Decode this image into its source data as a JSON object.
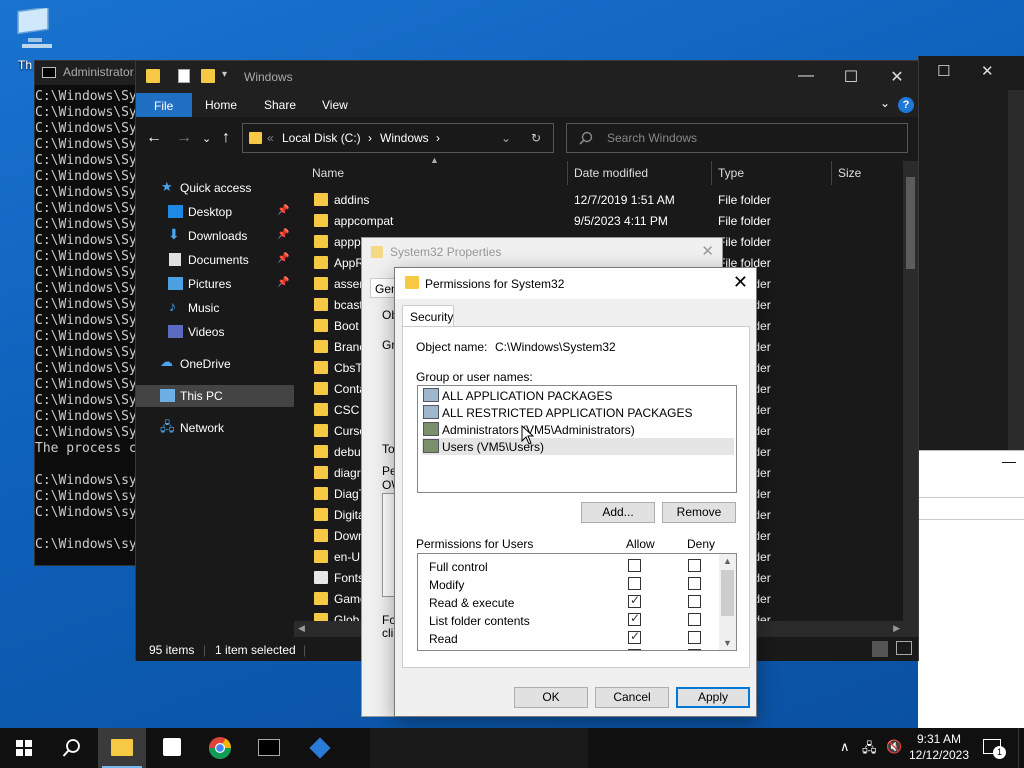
{
  "desktop": {
    "this_pc_label": "Th"
  },
  "cmd": {
    "title": "Administrator",
    "lines": [
      "C:\\Windows\\Sy",
      "C:\\Windows\\Sy",
      "C:\\Windows\\Sy",
      "C:\\Windows\\Sy",
      "C:\\Windows\\Sy",
      "C:\\Windows\\Sy",
      "C:\\Windows\\Sy",
      "C:\\Windows\\Sy",
      "C:\\Windows\\Sy",
      "C:\\Windows\\Sy",
      "C:\\Windows\\Sy",
      "C:\\Windows\\Sy",
      "C:\\Windows\\Sy",
      "C:\\Windows\\Sy",
      "C:\\Windows\\Sy",
      "C:\\Windows\\Sy",
      "C:\\Windows\\Sy",
      "C:\\Windows\\Sy",
      "C:\\Windows\\Sy",
      "C:\\Windows\\Sy",
      "C:\\Windows\\Sy",
      "C:\\Windows\\Sy",
      "The process c",
      "",
      "C:\\Windows\\sy",
      "C:\\Windows\\sy",
      "C:\\Windows\\sy",
      "",
      "C:\\Windows\\sy"
    ]
  },
  "explorer": {
    "title": "Windows",
    "ribbon": {
      "file": "File",
      "home": "Home",
      "share": "Share",
      "view": "View",
      "help": "?"
    },
    "address": {
      "overflow": "«",
      "disk": "Local Disk (C:)",
      "sep1": "›",
      "folder": "Windows",
      "sep2": "›"
    },
    "search_placeholder": "Search Windows",
    "nav": {
      "quick_access": "Quick access",
      "desktop": "Desktop",
      "downloads": "Downloads",
      "documents": "Documents",
      "pictures": "Pictures",
      "music": "Music",
      "videos": "Videos",
      "onedrive": "OneDrive",
      "this_pc": "This PC",
      "network": "Network"
    },
    "columns": {
      "name": "Name",
      "date": "Date modified",
      "type": "Type",
      "size": "Size"
    },
    "rows": [
      {
        "name": "addins",
        "date": "12/7/2019 1:51 AM",
        "type": "File folder"
      },
      {
        "name": "appcompat",
        "date": "9/5/2023 4:11 PM",
        "type": "File folder"
      },
      {
        "name": "appp",
        "date": "",
        "type": "File folder"
      },
      {
        "name": "AppR",
        "date": "",
        "type": "File folder"
      },
      {
        "name": "asser",
        "date": "",
        "type": "File folder"
      },
      {
        "name": "bcast",
        "date": "",
        "type": "File folder"
      },
      {
        "name": "Boot",
        "date": "",
        "type": "File folder"
      },
      {
        "name": "Branc",
        "date": "",
        "type": "File folder"
      },
      {
        "name": "CbsTe",
        "date": "",
        "type": "File folder"
      },
      {
        "name": "Conta",
        "date": "",
        "type": "File folder"
      },
      {
        "name": "CSC",
        "date": "",
        "type": "File folder"
      },
      {
        "name": "Cursc",
        "date": "",
        "type": "File folder"
      },
      {
        "name": "debu",
        "date": "",
        "type": "File folder"
      },
      {
        "name": "diagr",
        "date": "",
        "type": "File folder"
      },
      {
        "name": "DiagT",
        "date": "",
        "type": "File folder"
      },
      {
        "name": "Digita",
        "date": "",
        "type": "File folder"
      },
      {
        "name": "Down",
        "date": "",
        "type": "File folder"
      },
      {
        "name": "en-U",
        "date": "",
        "type": "File folder"
      },
      {
        "name": "Fonts",
        "date": "",
        "type": "File folder"
      },
      {
        "name": "Game",
        "date": "",
        "type": "File folder"
      },
      {
        "name": "Glob",
        "date": "",
        "type": "File folder"
      }
    ],
    "status": {
      "items": "95 items",
      "selected": "1 item selected"
    }
  },
  "properties": {
    "title": "System32 Properties",
    "tab": "Gen",
    "frag_ob": "Ob",
    "frag_gro": "Gro",
    "frag_to": "To",
    "frag_pe": "Pe",
    "frag_ow": "OW",
    "frag_for": "For",
    "frag_clic": "clic"
  },
  "permissions": {
    "title": "Permissions for System32",
    "close": "✕",
    "tab": "Security",
    "object_label": "Object name:",
    "object_value": "C:\\Windows\\System32",
    "group_label": "Group or user names:",
    "users": [
      "ALL APPLICATION PACKAGES",
      "ALL RESTRICTED APPLICATION PACKAGES",
      "Administrators (VM5\\Administrators)",
      "Users (VM5\\Users)"
    ],
    "add": "Add...",
    "remove": "Remove",
    "perm_for": "Permissions for Users",
    "allow": "Allow",
    "deny": "Deny",
    "perms": [
      {
        "name": "Full control",
        "allow": false,
        "deny": false
      },
      {
        "name": "Modify",
        "allow": false,
        "deny": false
      },
      {
        "name": "Read & execute",
        "allow": true,
        "deny": false
      },
      {
        "name": "List folder contents",
        "allow": true,
        "deny": false
      },
      {
        "name": "Read",
        "allow": true,
        "deny": false
      },
      {
        "name": "",
        "allow": false,
        "deny": false
      }
    ],
    "ok": "OK",
    "cancel": "Cancel",
    "apply": "Apply"
  },
  "taskbar": {
    "time": "9:31 AM",
    "date": "12/12/2023",
    "notify_count": "1"
  }
}
